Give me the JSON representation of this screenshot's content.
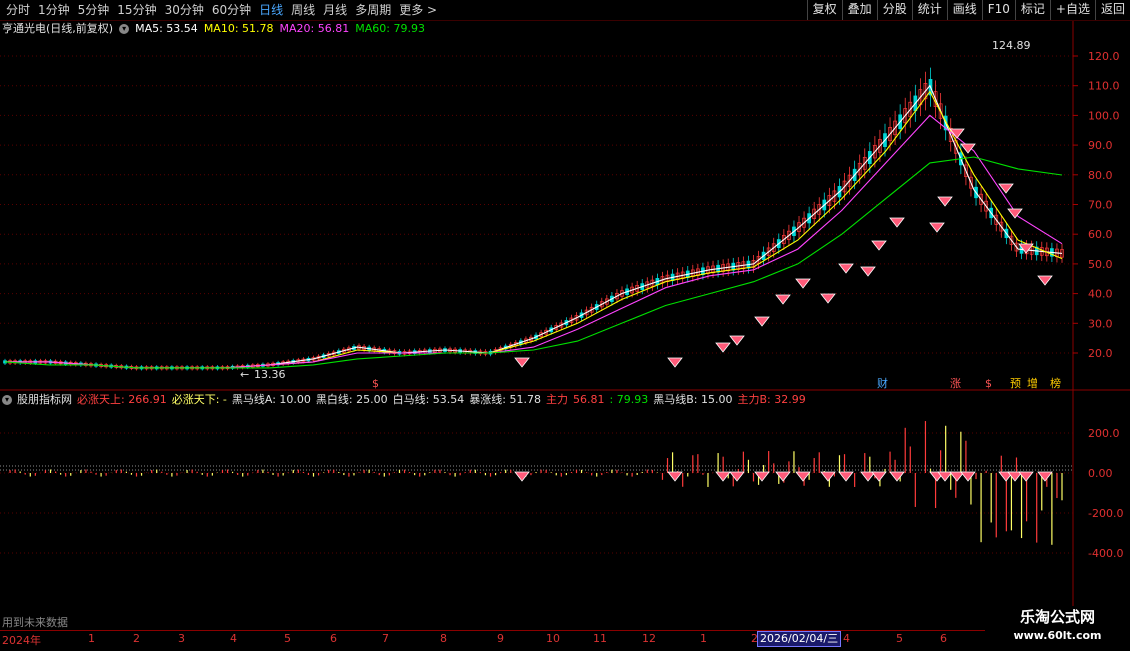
{
  "toolbar": {
    "periods": [
      "分时",
      "1分钟",
      "5分钟",
      "15分钟",
      "30分钟",
      "60分钟",
      "日线",
      "周线",
      "月线",
      "多周期",
      "更多 >"
    ],
    "active_period": "日线",
    "buttons": [
      "复权",
      "叠加",
      "分股",
      "统计",
      "画线",
      "F10",
      "标记",
      "+自选",
      "返回"
    ]
  },
  "main_legend": {
    "title": "亨通光电(日线,前复权)",
    "ma5_label": "MA5: 53.54",
    "ma10_label": "MA10: 51.78",
    "ma20_label": "MA20: 56.81",
    "ma60_label": "MA60: 79.93",
    "colors": {
      "ma5": "#ffffff",
      "ma10": "#ffff00",
      "ma20": "#ff44ff",
      "ma60": "#00e000"
    }
  },
  "indicator_legend": {
    "name": "股朋指标网",
    "items": [
      {
        "text": "必涨天上: 266.91",
        "color": "#ff4040"
      },
      {
        "text": "必涨天下: -",
        "color": "#ffff66"
      },
      {
        "text": "黑马线A: 10.00",
        "color": "#e0e0e0"
      },
      {
        "text": "黑白线: 25.00",
        "color": "#e0e0e0"
      },
      {
        "text": "白马线: 53.54",
        "color": "#e0e0e0"
      },
      {
        "text": "暴涨线: 51.78",
        "color": "#e0e0e0"
      },
      {
        "text": "主力",
        "color": "#ff4040"
      },
      {
        "text": "56.81",
        "color": "#ff4040"
      },
      {
        "text": ": 79.93",
        "color": "#00e000"
      },
      {
        "text": "黑马线B: 15.00",
        "color": "#e0e0e0"
      },
      {
        "text": "主力B: 32.99",
        "color": "#ff4040"
      }
    ]
  },
  "price_axis": [
    "120.0",
    "110.0",
    "100.0",
    "90.0",
    "80.0",
    "70.0",
    "60.0",
    "50.0",
    "40.0",
    "30.0",
    "20.0"
  ],
  "indicator_axis": [
    "200.0",
    "0.00",
    "-200.0",
    "-400.0"
  ],
  "price_high_label": "124.89",
  "price_low_label": "13.36",
  "event_markers": [
    "财",
    "涨",
    "$",
    "预",
    "增",
    "榜"
  ],
  "bottom_note": "用到未来数据",
  "time_axis": {
    "start_label": "2024年",
    "months": [
      "1",
      "2",
      "3",
      "4",
      "5",
      "6",
      "7",
      "8",
      "9",
      "10",
      "11",
      "12",
      "1",
      "2",
      "3",
      "4",
      "5",
      "6"
    ],
    "crosshair_date": "2026/02/04/三"
  },
  "watermark": {
    "line1": "乐淘公式网",
    "line2": "www.60lt.com"
  },
  "chart_data": {
    "type": "line",
    "title": "亨通光电(日线,前复权)",
    "price_range": [
      13.36,
      124.89
    ],
    "ylim": [
      15,
      125
    ],
    "indicator_ylim": [
      -500,
      300
    ],
    "series": [
      {
        "name": "MA5",
        "values": [
          17,
          17,
          16,
          15,
          15,
          15,
          16,
          18,
          22,
          20,
          21,
          20,
          25,
          32,
          40,
          45,
          48,
          50,
          62,
          75,
          92,
          110,
          75,
          55,
          53.54
        ]
      },
      {
        "name": "MA10",
        "values": [
          17,
          17,
          16,
          15,
          15,
          15,
          16,
          17,
          21,
          20,
          20,
          20,
          24,
          30,
          38,
          44,
          47,
          49,
          58,
          72,
          88,
          108,
          80,
          58,
          51.78
        ]
      },
      {
        "name": "MA20",
        "values": [
          17,
          17,
          16,
          15,
          15,
          15,
          16,
          17,
          20,
          20,
          20,
          20,
          22,
          28,
          35,
          42,
          46,
          48,
          55,
          68,
          84,
          100,
          88,
          66,
          56.81
        ]
      },
      {
        "name": "MA60",
        "values": [
          17,
          16,
          16,
          15,
          15,
          15,
          15,
          16,
          18,
          19,
          20,
          20,
          21,
          24,
          30,
          36,
          40,
          44,
          50,
          60,
          72,
          84,
          86,
          82,
          79.93
        ]
      }
    ]
  }
}
